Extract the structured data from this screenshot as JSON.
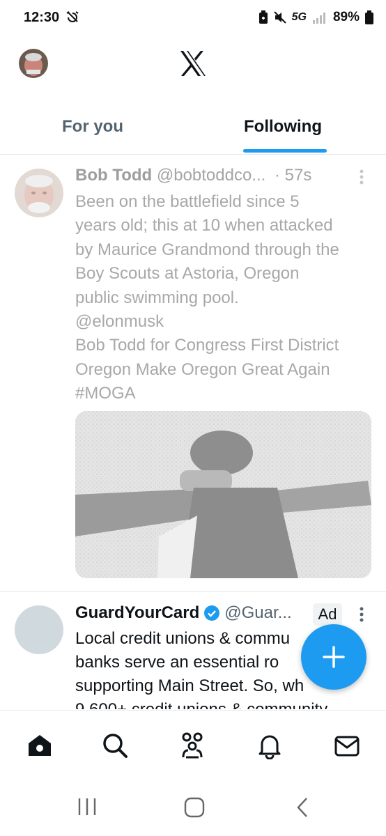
{
  "status_bar": {
    "time": "12:30",
    "network": "5G",
    "battery": "89%"
  },
  "header": {
    "logo": "x-logo-icon"
  },
  "tabs": [
    {
      "label": "For you",
      "selected": false
    },
    {
      "label": "Following",
      "selected": true
    }
  ],
  "accent_color": "#1d9bf0",
  "posts": [
    {
      "name": "Bob Todd",
      "handle": "@bobtoddco...",
      "time": "· 57s",
      "lines": [
        "Been on the battlefield since 5",
        "years old; this at 10 when attacked",
        "by Maurice Grandmond through the",
        "Boy Scouts at Astoria, Oregon",
        "public swimming pool.",
        "@elonmusk",
        "Bob Todd for Congress First District",
        "Oregon Make Oregon Great Again",
        "#MOGA"
      ]
    },
    {
      "name": "GuardYourCard",
      "handle": "@Guar...",
      "badge": "Ad",
      "lines": [
        "Local credit unions & commu",
        "banks serve an essential ro",
        "supporting Main Street. So, wh",
        "9,600+ credit unions & community"
      ]
    }
  ],
  "bottom_nav": [
    "home-icon",
    "search-icon",
    "communities-icon",
    "notifications-icon",
    "messages-icon"
  ]
}
